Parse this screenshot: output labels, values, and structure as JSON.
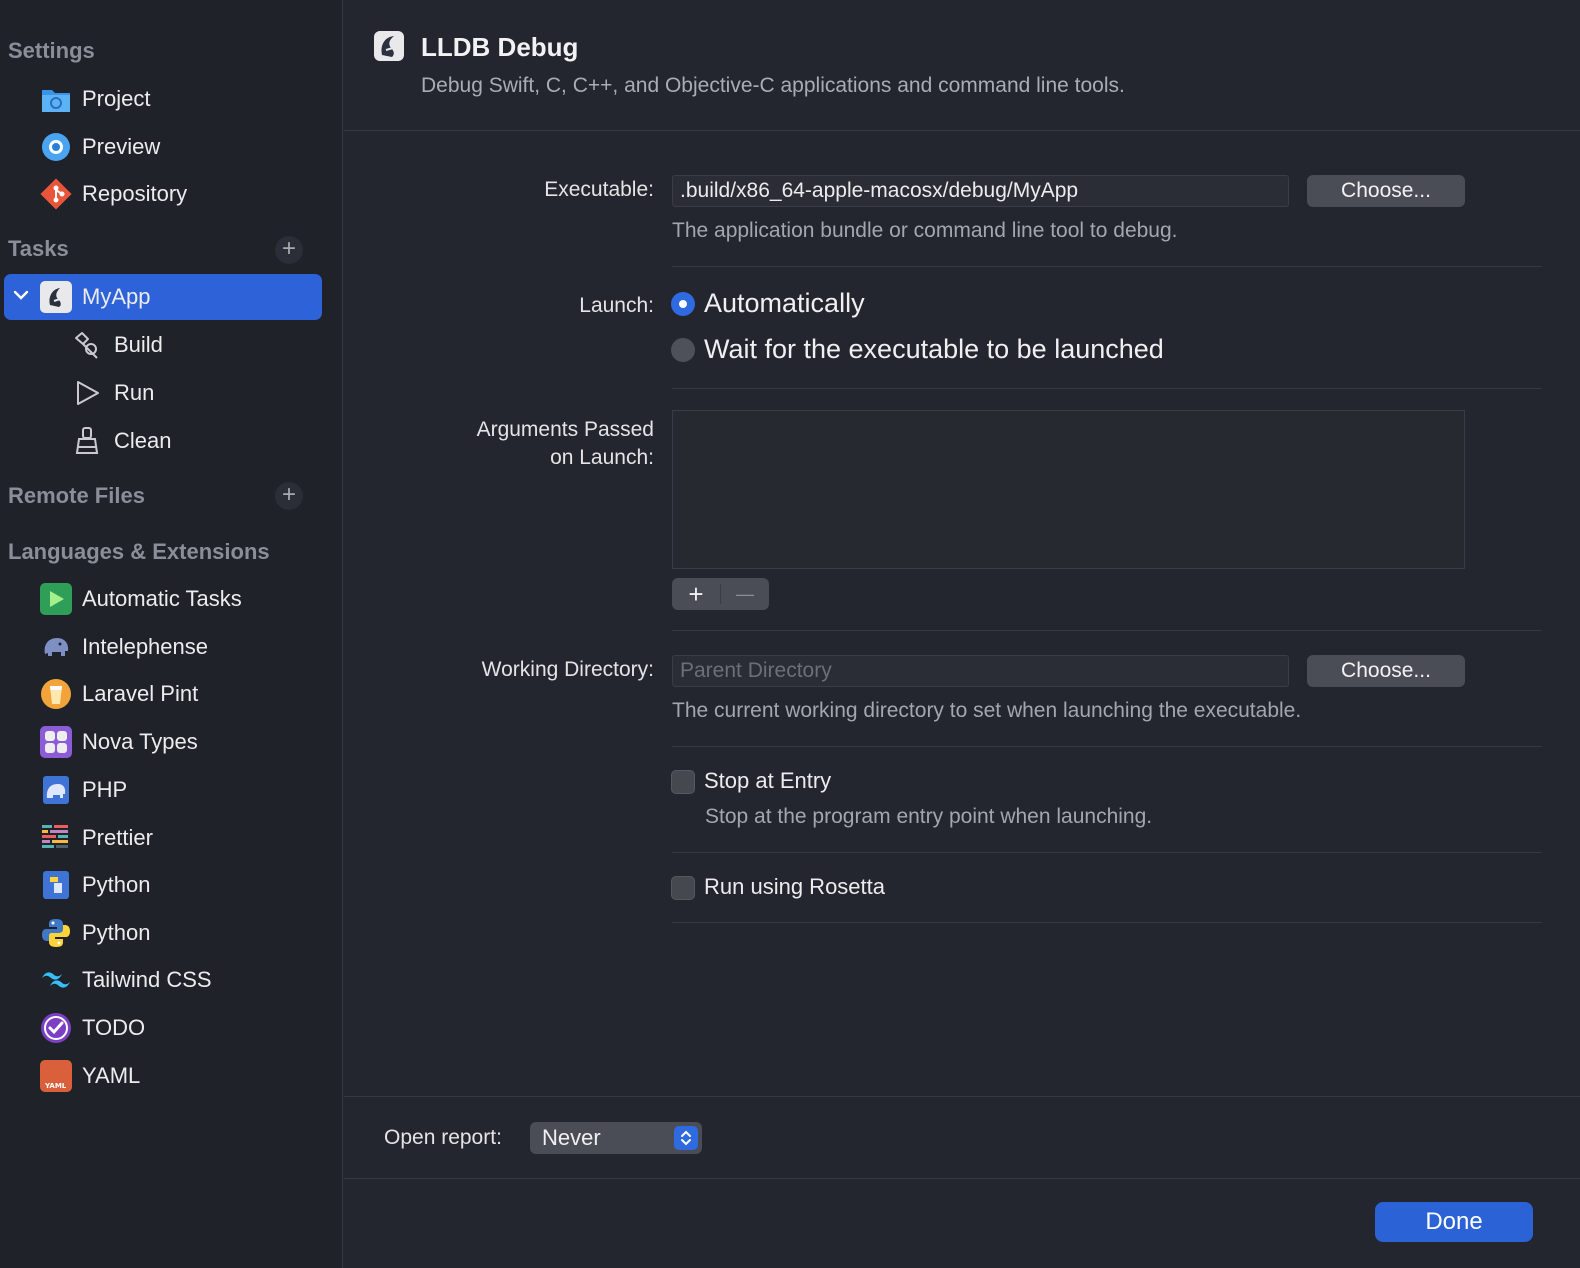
{
  "sidebar": {
    "sections": {
      "settings": "Settings",
      "tasks": "Tasks",
      "remote_files": "Remote Files",
      "languages": "Languages & Extensions"
    },
    "settings_items": [
      {
        "label": "Project",
        "icon": "folder-icon"
      },
      {
        "label": "Preview",
        "icon": "preview-icon"
      },
      {
        "label": "Repository",
        "icon": "git-icon"
      }
    ],
    "task": {
      "label": "MyApp",
      "icon": "lldb-icon",
      "selected": true
    },
    "task_items": [
      {
        "label": "Build",
        "icon": "hammer-icon"
      },
      {
        "label": "Run",
        "icon": "play-icon"
      },
      {
        "label": "Clean",
        "icon": "broom-icon"
      }
    ],
    "extensions": [
      {
        "label": "Automatic Tasks"
      },
      {
        "label": "Intelephense"
      },
      {
        "label": "Laravel Pint"
      },
      {
        "label": "Nova Types"
      },
      {
        "label": "PHP"
      },
      {
        "label": "Prettier"
      },
      {
        "label": "Python"
      },
      {
        "label": "Python"
      },
      {
        "label": "Tailwind CSS"
      },
      {
        "label": "TODO"
      },
      {
        "label": "YAML"
      }
    ],
    "add_symbol": "+"
  },
  "header": {
    "title": "LLDB Debug",
    "subtitle": "Debug Swift, C, C++, and Objective-C applications and command line tools."
  },
  "form": {
    "executable": {
      "label": "Executable:",
      "value": ".build/x86_64-apple-macosx/debug/MyApp",
      "button": "Choose...",
      "help": "The application bundle or command line tool to debug."
    },
    "launch": {
      "label": "Launch:",
      "options": [
        "Automatically",
        "Wait for the executable to be launched"
      ],
      "selected": 0
    },
    "arguments": {
      "label_line1": "Arguments Passed",
      "label_line2": "on Launch:",
      "add": "+",
      "remove": "—"
    },
    "working_directory": {
      "label": "Working Directory:",
      "placeholder": "Parent Directory",
      "button": "Choose...",
      "help": "The current working directory to set when launching the executable."
    },
    "stop_at_entry": {
      "label": "Stop at Entry",
      "help": "Stop at the program entry point when launching.",
      "checked": false
    },
    "rosetta": {
      "label": "Run using Rosetta",
      "checked": false
    }
  },
  "footer": {
    "open_report_label": "Open report:",
    "open_report_value": "Never",
    "done": "Done"
  },
  "colors": {
    "accent": "#2e62d8",
    "background": "#23262e",
    "sidebar": "#1f2229"
  }
}
